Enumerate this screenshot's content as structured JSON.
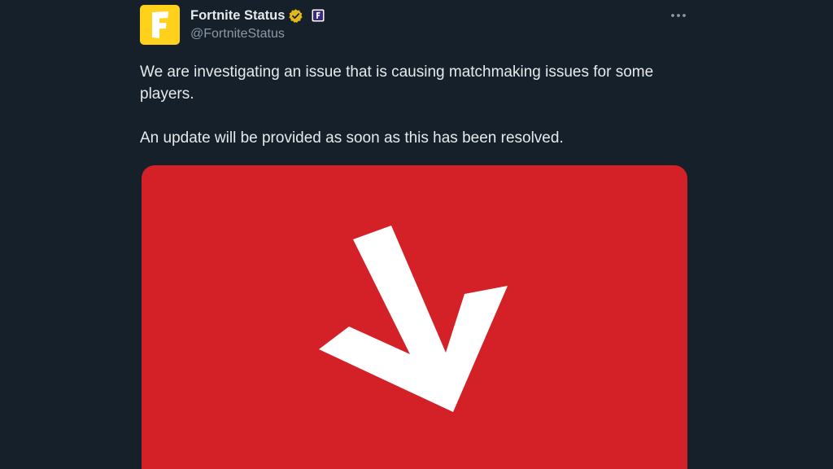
{
  "tweet": {
    "avatar_icon": "fortnite-f-logo",
    "display_name": "Fortnite Status",
    "handle": "@FortniteStatus",
    "verified_icon": "gold-verified-badge",
    "affiliate_icon": "fortnite-affiliate-badge",
    "more_icon": "more-horizontal-icon",
    "text_line_1": "We are investigating an issue that is causing matchmaking issues for some players.",
    "text_line_2": "An update will be provided as soon as this has been resolved.",
    "media_icon": "downward-arrow-graphic"
  },
  "colors": {
    "background": "#15202b",
    "text_primary": "#e7e9ea",
    "text_secondary": "#8b98a5",
    "avatar_bg": "#ffd11a",
    "verified_gold": "#e2b719",
    "media_bg": "#d42027"
  }
}
